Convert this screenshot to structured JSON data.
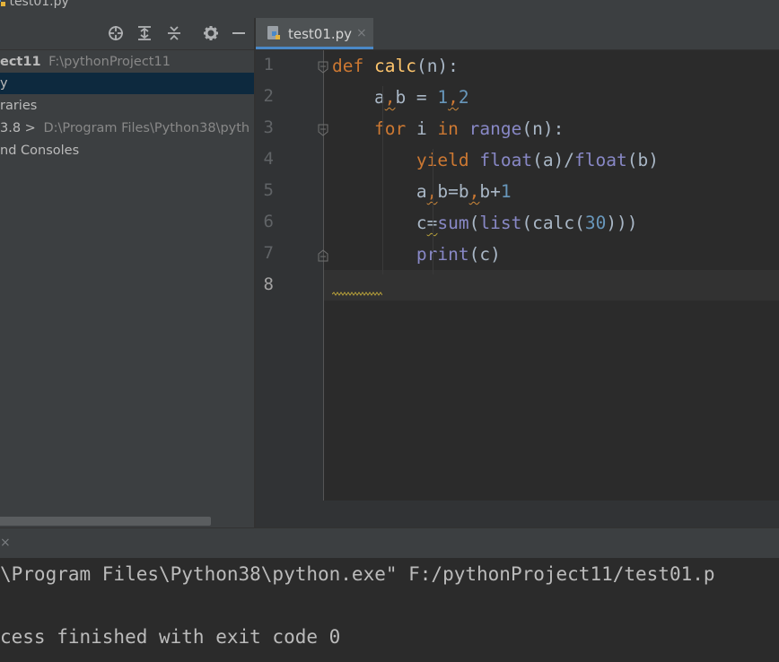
{
  "window": {
    "file_label": "test01.py"
  },
  "project_panel": {
    "toolbar_icons": [
      "locate-icon",
      "expand-all-icon",
      "collapse-all-icon",
      "gear-icon",
      "minimize-icon"
    ],
    "tree": [
      {
        "bold": "ect11",
        "dim": "F:\\pythonProject11"
      },
      {
        "text": "y"
      },
      {
        "text": "raries"
      },
      {
        "text": "3.8 >",
        "dim": "D:\\Program Files\\Python38\\pyth"
      },
      {
        "text": "nd Consoles"
      }
    ]
  },
  "editor": {
    "tab": {
      "label": "test01.py",
      "close": "×"
    },
    "line_numbers": [
      "1",
      "2",
      "3",
      "4",
      "5",
      "6",
      "7",
      "8"
    ],
    "lines": [
      [
        {
          "t": "def",
          "c": "kw"
        },
        {
          "t": " ",
          "c": "id"
        },
        {
          "t": "calc",
          "c": "fn"
        },
        {
          "t": "(n):",
          "c": "id"
        }
      ],
      [
        {
          "t": "    a",
          "c": "id"
        },
        {
          "t": ",",
          "c": "kw",
          "w": 1
        },
        {
          "t": "b = ",
          "c": "id"
        },
        {
          "t": "1",
          "c": "num"
        },
        {
          "t": ",",
          "c": "kw",
          "w": 1
        },
        {
          "t": "2",
          "c": "num"
        }
      ],
      [
        {
          "t": "    ",
          "c": "id"
        },
        {
          "t": "for",
          "c": "kw"
        },
        {
          "t": " i ",
          "c": "id"
        },
        {
          "t": "in",
          "c": "kw"
        },
        {
          "t": " ",
          "c": "id"
        },
        {
          "t": "range",
          "c": "bi"
        },
        {
          "t": "(n):",
          "c": "id"
        }
      ],
      [
        {
          "t": "        ",
          "c": "id"
        },
        {
          "t": "yield",
          "c": "kw"
        },
        {
          "t": " ",
          "c": "id"
        },
        {
          "t": "float",
          "c": "bi"
        },
        {
          "t": "(a)/",
          "c": "id"
        },
        {
          "t": "float",
          "c": "bi"
        },
        {
          "t": "(b)",
          "c": "id"
        }
      ],
      [
        {
          "t": "        a",
          "c": "id"
        },
        {
          "t": ",",
          "c": "kw",
          "w": 1
        },
        {
          "t": "b=b",
          "c": "id"
        },
        {
          "t": ",",
          "c": "kw",
          "w": 1
        },
        {
          "t": "b+",
          "c": "id"
        },
        {
          "t": "1",
          "c": "num"
        }
      ],
      [
        {
          "t": "        c",
          "c": "id"
        },
        {
          "t": "=",
          "c": "id",
          "w": 2
        },
        {
          "t": "sum",
          "c": "bi"
        },
        {
          "t": "(",
          "c": "id"
        },
        {
          "t": "list",
          "c": "bi"
        },
        {
          "t": "(calc(",
          "c": "id"
        },
        {
          "t": "30",
          "c": "num"
        },
        {
          "t": ")))",
          "c": "id"
        }
      ],
      [
        {
          "t": "        ",
          "c": "id"
        },
        {
          "t": "print",
          "c": "bi"
        },
        {
          "t": "(c)",
          "c": "id"
        }
      ],
      [
        {
          "t": "",
          "c": "id"
        }
      ]
    ]
  },
  "run_panel": {
    "close": "×",
    "output": [
      "\\Program Files\\Python38\\python.exe\" F:/pythonProject11/test01.p",
      "",
      "cess finished with exit code 0"
    ]
  }
}
